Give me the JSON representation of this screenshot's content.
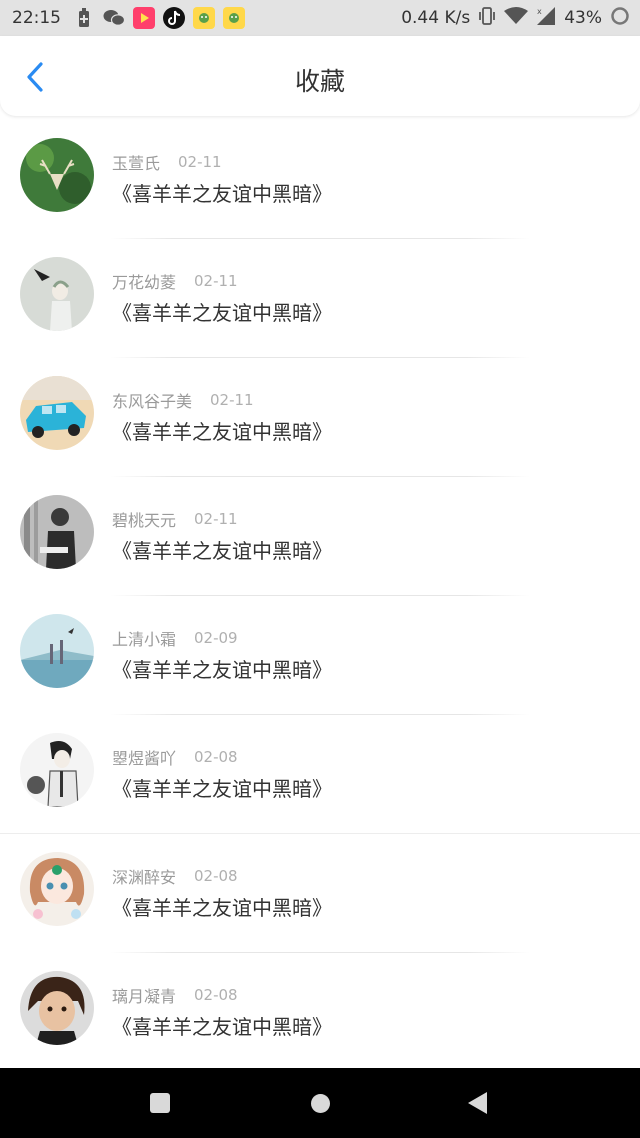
{
  "status_bar": {
    "time": "22:15",
    "net_speed": "0.44 K/s",
    "battery": "43%",
    "icons": [
      "battery-saver-icon",
      "wechat-icon",
      "video-app-icon",
      "tiktok-icon",
      "notification-app-icon",
      "notification-app-icon-2",
      "vibrate-icon",
      "wifi-icon",
      "signal-icon",
      "loading-ring-icon"
    ]
  },
  "header": {
    "title": "收藏",
    "back_icon": "chevron-left-icon",
    "accent": "#2a8bf2"
  },
  "favorites": [
    {
      "name": "玉萱氏",
      "date": "02-11",
      "book": "《喜羊羊之友谊中黑暗》"
    },
    {
      "name": "万花幼菱",
      "date": "02-11",
      "book": "《喜羊羊之友谊中黑暗》"
    },
    {
      "name": "东风谷子美",
      "date": "02-11",
      "book": "《喜羊羊之友谊中黑暗》"
    },
    {
      "name": "碧桃天元",
      "date": "02-11",
      "book": "《喜羊羊之友谊中黑暗》"
    },
    {
      "name": "上清小霜",
      "date": "02-09",
      "book": "《喜羊羊之友谊中黑暗》"
    },
    {
      "name": "曌煜酱吖",
      "date": "02-08",
      "book": "《喜羊羊之友谊中黑暗》"
    },
    {
      "name": "深渊醉安",
      "date": "02-08",
      "book": "《喜羊羊之友谊中黑暗》"
    },
    {
      "name": "璃月凝青",
      "date": "02-08",
      "book": "《喜羊羊之友谊中黑暗》"
    }
  ],
  "nav_bar": {
    "buttons": [
      "recent-apps-icon",
      "home-icon",
      "back-triangle-icon"
    ]
  }
}
